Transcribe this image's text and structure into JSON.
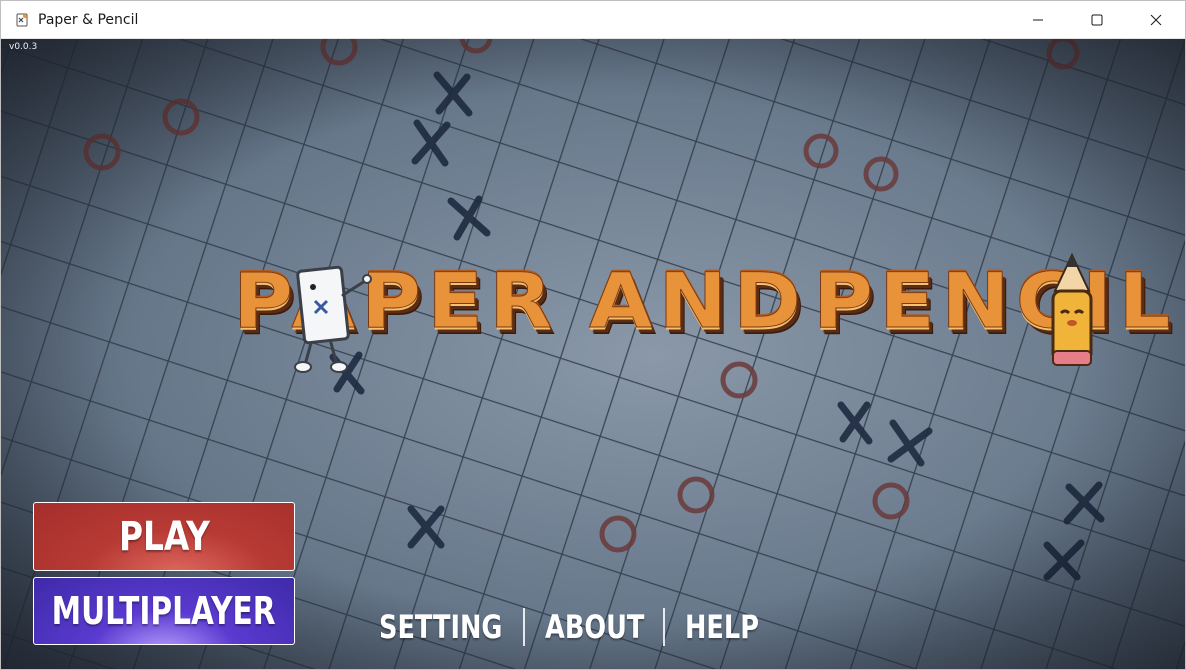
{
  "window": {
    "title": "Paper & Pencil",
    "icon": "app-pencil-icon",
    "controls": [
      "minimize-icon",
      "maximize-icon",
      "close-icon"
    ]
  },
  "game": {
    "version": "v0.0.3",
    "logo": {
      "word_paper": "PAPER",
      "word_and": "AND",
      "word_pencil": "PENCIL"
    },
    "buttons": {
      "play": "PLAY",
      "multiplayer": "MULTIPLAYER"
    },
    "sub_menu": {
      "setting": "SETTING",
      "about": "ABOUT",
      "help": "HELP"
    }
  },
  "colors": {
    "play_button": "#b83a35",
    "multiplayer_button": "#4a30b8",
    "logo_orange": "#e8923a",
    "background_grid": "#5a6a7d"
  }
}
